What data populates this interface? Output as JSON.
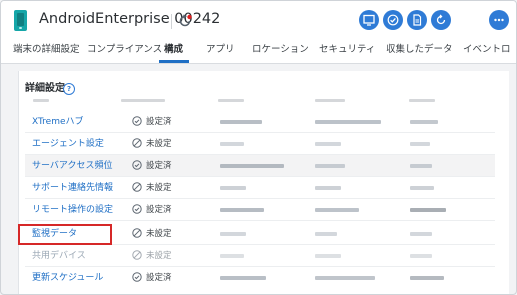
{
  "header": {
    "title": "AndroidEnterprise 00242",
    "actions": [
      {
        "name": "screen-icon"
      },
      {
        "name": "check-icon"
      },
      {
        "name": "document-icon"
      },
      {
        "name": "refresh-icon"
      },
      {
        "name": "more-icon"
      }
    ]
  },
  "tabs": {
    "items": [
      {
        "label": "端末の詳細設定"
      },
      {
        "label": "コンプライアンス"
      },
      {
        "label": "構成",
        "active": true
      },
      {
        "label": "アプリ"
      },
      {
        "label": "ロケーション"
      },
      {
        "label": "セキュリティ"
      },
      {
        "label": "収集したデータ"
      },
      {
        "label": "イベントロ"
      }
    ]
  },
  "section": {
    "title": "詳細設定",
    "help": "?"
  },
  "rows": [
    {
      "label": "XTremeハブ",
      "status": "設定済",
      "state": "set"
    },
    {
      "label": "エージェント設定",
      "status": "未設定",
      "state": "unset"
    },
    {
      "label": "サーバアクセス頻位",
      "status": "設定済",
      "state": "set"
    },
    {
      "label": "サポート連絡先情報",
      "status": "未設定",
      "state": "unset"
    },
    {
      "label": "リモート操作の設定",
      "status": "設定済",
      "state": "set"
    },
    {
      "label": "監視データ",
      "status": "未設定",
      "state": "unset"
    },
    {
      "label": "共用デバイス",
      "status": "未設定",
      "state": "disabled"
    },
    {
      "label": "更新スケジュール",
      "status": "設定済",
      "state": "set"
    }
  ],
  "colors": {
    "accent": "#1f6fc5",
    "button": "#2f7bd6",
    "device": "#15a6a8",
    "highlight": "#d62828",
    "badge": "#e02020"
  }
}
